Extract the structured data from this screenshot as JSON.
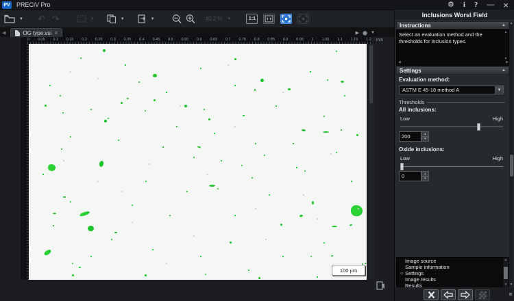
{
  "colors": {
    "accent_blue": "#2f76d2",
    "inclusion_green": "#1fc32b"
  },
  "titlebar": {
    "logo": "PV",
    "app_title": "PRECiV Pro"
  },
  "toolbar": {
    "zoom_level": "40.2 %",
    "one_to_one": "1:1"
  },
  "tabs": [
    {
      "label": "OG type.vsi"
    }
  ],
  "ruler": {
    "unit": "mm",
    "labels": [
      "0",
      "0.05",
      "0.1",
      "0.15",
      "0.2",
      "0.25",
      "0.3",
      "0.35",
      "0.4",
      "0.45",
      "0.5",
      "0.55",
      "0.6",
      "0.65",
      "0.7",
      "0.75",
      "0.8",
      "0.85",
      "0.9",
      "0.95",
      "1",
      "1.05",
      "1.1",
      "1.15",
      "1.2"
    ]
  },
  "image": {
    "scale_bar": "100 µm",
    "inclusions": [
      [
        108,
        8,
        4,
        4,
        0
      ],
      [
        181,
        44,
        6,
        5,
        0
      ],
      [
        134,
        85,
        3,
        3,
        0
      ],
      [
        143,
        79,
        3,
        2,
        0
      ],
      [
        182,
        81,
        3,
        3,
        0
      ],
      [
        227,
        89,
        4,
        4,
        0
      ],
      [
        23,
        89,
        3,
        3,
        0
      ],
      [
        49,
        100,
        2,
        2,
        0
      ],
      [
        110,
        111,
        4,
        4,
        0
      ],
      [
        115,
        108,
        2,
        2,
        0
      ],
      [
        47,
        153,
        2,
        2,
        0
      ],
      [
        246,
        150,
        5,
        2,
        20
      ],
      [
        28,
        176,
        11,
        10,
        0
      ],
      [
        103,
        171,
        6,
        9,
        15
      ],
      [
        50,
        223,
        4,
        2,
        0
      ],
      [
        74,
        246,
        15,
        5,
        -20
      ],
      [
        35,
        247,
        5,
        2,
        0
      ],
      [
        86,
        266,
        9,
        8,
        0
      ],
      [
        125,
        275,
        4,
        2,
        0
      ],
      [
        22,
        302,
        11,
        6,
        -35
      ],
      [
        63,
        320,
        2,
        2,
        0
      ],
      [
        73,
        326,
        3,
        2,
        0
      ],
      [
        63,
        337,
        3,
        3,
        0
      ],
      [
        169,
        337,
        3,
        3,
        0
      ],
      [
        300,
        21,
        3,
        3,
        0
      ],
      [
        448,
        10,
        2,
        2,
        0
      ],
      [
        338,
        51,
        5,
        5,
        0
      ],
      [
        329,
        66,
        2,
        3,
        0
      ],
      [
        378,
        65,
        4,
        3,
        0
      ],
      [
        435,
        52,
        2,
        2,
        0
      ],
      [
        455,
        54,
        5,
        3,
        0
      ],
      [
        262,
        109,
        3,
        3,
        0
      ],
      [
        312,
        104,
        3,
        2,
        0
      ],
      [
        398,
        125,
        6,
        3,
        10
      ],
      [
        429,
        128,
        9,
        2,
        0
      ],
      [
        478,
        132,
        3,
        3,
        0
      ],
      [
        448,
        158,
        2,
        2,
        0
      ],
      [
        343,
        162,
        2,
        2,
        0
      ],
      [
        310,
        177,
        2,
        2,
        0
      ],
      [
        402,
        185,
        2,
        2,
        0
      ],
      [
        263,
        206,
        9,
        3,
        0
      ],
      [
        275,
        211,
        2,
        2,
        0
      ],
      [
        413,
        230,
        3,
        5,
        0
      ],
      [
        470,
        236,
        17,
        16,
        0
      ],
      [
        395,
        250,
        5,
        3,
        -15
      ],
      [
        367,
        263,
        3,
        3,
        0
      ],
      [
        442,
        266,
        8,
        2,
        0
      ],
      [
        468,
        264,
        4,
        2,
        -20
      ],
      [
        293,
        289,
        3,
        3,
        0
      ],
      [
        257,
        336,
        2,
        2,
        0
      ],
      [
        335,
        341,
        3,
        3,
        0
      ],
      [
        411,
        310,
        2,
        2,
        0
      ],
      [
        441,
        309,
        3,
        2,
        0
      ],
      [
        169,
        97,
        2,
        2,
        0
      ],
      [
        486,
        321,
        2,
        2,
        0
      ]
    ],
    "specks": [
      [
        75,
        20
      ],
      [
        250,
        35
      ],
      [
        160,
        55
      ],
      [
        30,
        60
      ],
      [
        200,
        70
      ],
      [
        90,
        95
      ],
      [
        270,
        130
      ],
      [
        60,
        135
      ],
      [
        130,
        140
      ],
      [
        195,
        150
      ],
      [
        240,
        165
      ],
      [
        20,
        190
      ],
      [
        170,
        200
      ],
      [
        230,
        215
      ],
      [
        60,
        230
      ],
      [
        150,
        235
      ],
      [
        205,
        250
      ],
      [
        35,
        265
      ],
      [
        120,
        285
      ],
      [
        180,
        300
      ],
      [
        250,
        310
      ],
      [
        90,
        310
      ],
      [
        300,
        60
      ],
      [
        360,
        90
      ],
      [
        410,
        40
      ],
      [
        460,
        75
      ],
      [
        430,
        105
      ],
      [
        330,
        145
      ],
      [
        390,
        180
      ],
      [
        470,
        200
      ],
      [
        350,
        220
      ],
      [
        300,
        250
      ],
      [
        430,
        290
      ],
      [
        370,
        310
      ],
      [
        490,
        320
      ],
      [
        320,
        330
      ],
      [
        420,
        340
      ],
      [
        280,
        170
      ],
      [
        255,
        95
      ],
      [
        140,
        30
      ],
      [
        215,
        120
      ],
      [
        45,
        75
      ],
      [
        385,
        145
      ],
      [
        325,
        195
      ],
      [
        455,
        125
      ]
    ],
    "dust": [
      [
        100,
        50
      ],
      [
        220,
        90
      ],
      [
        300,
        120
      ],
      [
        50,
        170
      ],
      [
        260,
        190
      ],
      [
        330,
        240
      ],
      [
        150,
        260
      ],
      [
        400,
        220
      ],
      [
        440,
        160
      ],
      [
        200,
        320
      ],
      [
        100,
        200
      ],
      [
        370,
        70
      ],
      [
        480,
        240
      ],
      [
        240,
        280
      ],
      [
        60,
        40
      ],
      [
        290,
        30
      ],
      [
        420,
        255
      ],
      [
        175,
        175
      ],
      [
        345,
        285
      ],
      [
        135,
        215
      ]
    ]
  },
  "right_panel": {
    "title": "Inclusions Worst Field",
    "instructions": {
      "header": "Instructions",
      "text": "Select an evaluation method and the thresholds for inclusion types."
    },
    "settings": {
      "header": "Settings",
      "evaluation_method_label": "Evaluation method:",
      "evaluation_method_value": "ASTM E 45-18 method A",
      "thresholds_group_label": "Thresholds",
      "all_inclusions": {
        "label": "All inclusions:",
        "low": "Low",
        "high": "High",
        "value": "200",
        "slider_percent": 76
      },
      "oxide_inclusions": {
        "label": "Oxide inclusions:",
        "low": "Low",
        "high": "High",
        "value": "0",
        "slider_percent": 1
      }
    },
    "navigation": {
      "items": [
        {
          "label": "Image source",
          "current": false
        },
        {
          "label": "Sample information",
          "current": false
        },
        {
          "label": "Settings",
          "current": true
        },
        {
          "label": "Image results",
          "current": false
        },
        {
          "label": "Results",
          "current": false
        }
      ]
    }
  }
}
